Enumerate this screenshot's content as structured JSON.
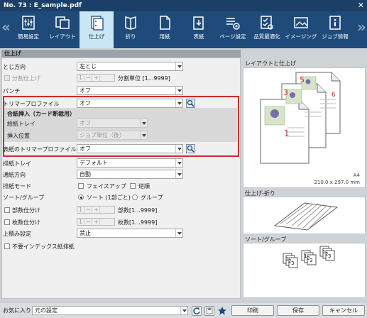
{
  "window": {
    "title": "No. 73 : E_sample.pdf",
    "close_symbol": "✕"
  },
  "toolbar": {
    "left_arrow": "«",
    "right_arrow": "»",
    "tabs": [
      {
        "label": "簡易設定",
        "icon": "simple-settings-icon"
      },
      {
        "label": "レイアウト",
        "icon": "layout-icon"
      },
      {
        "label": "仕上げ",
        "icon": "finishing-icon",
        "active": true
      },
      {
        "label": "折り",
        "icon": "fold-icon"
      },
      {
        "label": "用紙",
        "icon": "paper-icon"
      },
      {
        "label": "表紙",
        "icon": "cover-icon"
      },
      {
        "label": "ページ設定",
        "icon": "page-settings-icon"
      },
      {
        "label": "品質最適化",
        "icon": "quality-icon"
      },
      {
        "label": "イメージング",
        "icon": "imaging-icon"
      },
      {
        "label": "ジョブ情報",
        "icon": "job-info-icon"
      }
    ],
    "active_color": "#c9e6f6"
  },
  "section": {
    "title": "仕上げ"
  },
  "settings": {
    "binding": {
      "label": "とじ方向",
      "value": "左とじ"
    },
    "split": {
      "label": "分割仕上げ",
      "value": "1",
      "suffix": "分割単位 [1...9999]"
    },
    "punch": {
      "label": "パンチ",
      "value": "オフ"
    },
    "trimmer": {
      "label": "トリマープロファイル",
      "value": "オフ"
    },
    "insert": {
      "title": "合紙挿入（カード断裁用）",
      "tray": {
        "label": "給紙トレイ",
        "value": "オフ"
      },
      "position": {
        "label": "挿入位置",
        "value": "ジョブ単位（後）"
      }
    },
    "cover_trimmer": {
      "label": "表紙のトリマープロファイル",
      "value": "オフ"
    },
    "output_tray": {
      "label": "排紙トレイ",
      "value": "デフォルト"
    },
    "feed_direction": {
      "label": "通紙方向",
      "value": "自動"
    },
    "output_mode": {
      "label": "排紙モード",
      "face_up": "フェイスアップ",
      "reverse": "逆順"
    },
    "sort_group": {
      "label": "ソート/グループ",
      "sort": "ソート (1部ごと)",
      "group": "グループ"
    },
    "copies_split": {
      "label": "部数仕分け",
      "value": "1",
      "suffix": "部数[1...9999]"
    },
    "sheets_split": {
      "label": "枚数仕分け",
      "value": "1",
      "suffix": "枚数[1...9999]"
    },
    "stack": {
      "label": "上積み設定",
      "value": "禁止"
    },
    "no_index": {
      "label": "不要インデックス紙排紙"
    }
  },
  "preview": {
    "layout_title": "レイアウトと仕上げ",
    "page_numbers": [
      "1",
      "3",
      "5"
    ],
    "page_numbers_back": [
      "6"
    ],
    "paper_size": "A4",
    "paper_dims": "210.0 x 297.0 mm",
    "fold_title": "仕上げ-折り",
    "sort_title": "ソート/グループ",
    "sort_digits": [
      "1",
      "2",
      "3"
    ],
    "page_number_color": "#d32a2a"
  },
  "bottom": {
    "favorite_label": "お気に入り",
    "favorite_value": "元の設定",
    "print": "印刷",
    "save": "保存",
    "cancel": "キャンセル",
    "refresh_icon": "refresh-icon",
    "disk_icon": "disk-icon",
    "star_icon": "star-icon"
  }
}
